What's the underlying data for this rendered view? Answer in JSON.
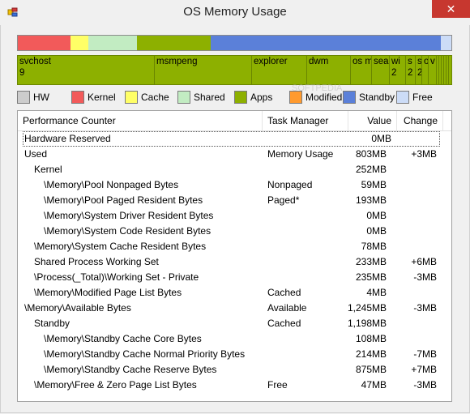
{
  "window": {
    "title": "OS Memory Usage",
    "close_label": "✕",
    "icon": "app-icon"
  },
  "memory_bar": [
    {
      "name": "Kernel",
      "color": "#f25a5a",
      "fraction": 0.122
    },
    {
      "name": "Cache",
      "color": "#ffff66",
      "fraction": 0.04
    },
    {
      "name": "Shared",
      "color": "#c2ecc2",
      "fraction": 0.112
    },
    {
      "name": "Apps",
      "color": "#8db000",
      "fraction": 0.17
    },
    {
      "name": "Standby",
      "color": "#5b80d9",
      "fraction": 0.532
    },
    {
      "name": "Free",
      "color": "#ccdcf7",
      "fraction": 0.024
    }
  ],
  "processes": [
    {
      "name": "svchost",
      "sub": "9"
    },
    {
      "name": "msmpeng",
      "sub": ""
    },
    {
      "name": "explorer",
      "sub": ""
    },
    {
      "name": "dwm",
      "sub": ""
    },
    {
      "name": "os me",
      "sub": ""
    },
    {
      "name": "sea",
      "sub": ""
    },
    {
      "name": "wi",
      "sub": "2"
    },
    {
      "name": "s",
      "sub": "2"
    },
    {
      "name": "sl",
      "sub": "2"
    },
    {
      "name": "o",
      "sub": ""
    },
    {
      "name": "v",
      "sub": ""
    }
  ],
  "legend": [
    {
      "label": "HW",
      "color": "#cccccc"
    },
    {
      "label": "Kernel",
      "color": "#f25a5a"
    },
    {
      "label": "Cache",
      "color": "#ffff66"
    },
    {
      "label": "Shared",
      "color": "#c2ecc2"
    },
    {
      "label": "Apps",
      "color": "#8db000"
    },
    {
      "label": "Modified",
      "color": "#ff9a2e"
    },
    {
      "label": "Standby",
      "color": "#5b80d9"
    },
    {
      "label": "Free",
      "color": "#ccdcf7"
    }
  ],
  "table": {
    "headers": {
      "counter": "Performance Counter",
      "task": "Task Manager",
      "value": "Value",
      "change": "Change"
    },
    "rows": [
      {
        "counter": "Hardware Reserved",
        "indent": 0,
        "task": "",
        "value": "0MB",
        "change": ""
      },
      {
        "counter": "Used",
        "indent": 0,
        "task": "Memory Usage",
        "value": "803MB",
        "change": "+3MB"
      },
      {
        "counter": "Kernel",
        "indent": 1,
        "task": "",
        "value": "252MB",
        "change": ""
      },
      {
        "counter": "\\Memory\\Pool Nonpaged Bytes",
        "indent": 2,
        "task": "Nonpaged",
        "value": "59MB",
        "change": ""
      },
      {
        "counter": "\\Memory\\Pool Paged Resident Bytes",
        "indent": 2,
        "task": "Paged*",
        "value": "193MB",
        "change": ""
      },
      {
        "counter": "\\Memory\\System Driver Resident Bytes",
        "indent": 2,
        "task": "",
        "value": "0MB",
        "change": ""
      },
      {
        "counter": "\\Memory\\System Code Resident Bytes",
        "indent": 2,
        "task": "",
        "value": "0MB",
        "change": ""
      },
      {
        "counter": "\\Memory\\System Cache Resident Bytes",
        "indent": 1,
        "task": "",
        "value": "78MB",
        "change": ""
      },
      {
        "counter": "Shared Process Working Set",
        "indent": 1,
        "task": "",
        "value": "233MB",
        "change": "+6MB"
      },
      {
        "counter": "\\Process(_Total)\\Working Set - Private",
        "indent": 1,
        "task": "",
        "value": "235MB",
        "change": "-3MB"
      },
      {
        "counter": "\\Memory\\Modified Page List Bytes",
        "indent": 1,
        "task": "Cached",
        "value": "4MB",
        "change": ""
      },
      {
        "counter": "\\Memory\\Available Bytes",
        "indent": 0,
        "task": "Available",
        "value": "1,245MB",
        "change": "-3MB"
      },
      {
        "counter": "Standby",
        "indent": 1,
        "task": "Cached",
        "value": "1,198MB",
        "change": ""
      },
      {
        "counter": "\\Memory\\Standby Cache Core Bytes",
        "indent": 2,
        "task": "",
        "value": "108MB",
        "change": ""
      },
      {
        "counter": "\\Memory\\Standby Cache Normal Priority Bytes",
        "indent": 2,
        "task": "",
        "value": "214MB",
        "change": "-7MB"
      },
      {
        "counter": "\\Memory\\Standby Cache Reserve Bytes",
        "indent": 2,
        "task": "",
        "value": "875MB",
        "change": "+7MB"
      },
      {
        "counter": "\\Memory\\Free & Zero Page List Bytes",
        "indent": 1,
        "task": "Free",
        "value": "47MB",
        "change": "-3MB"
      }
    ]
  }
}
